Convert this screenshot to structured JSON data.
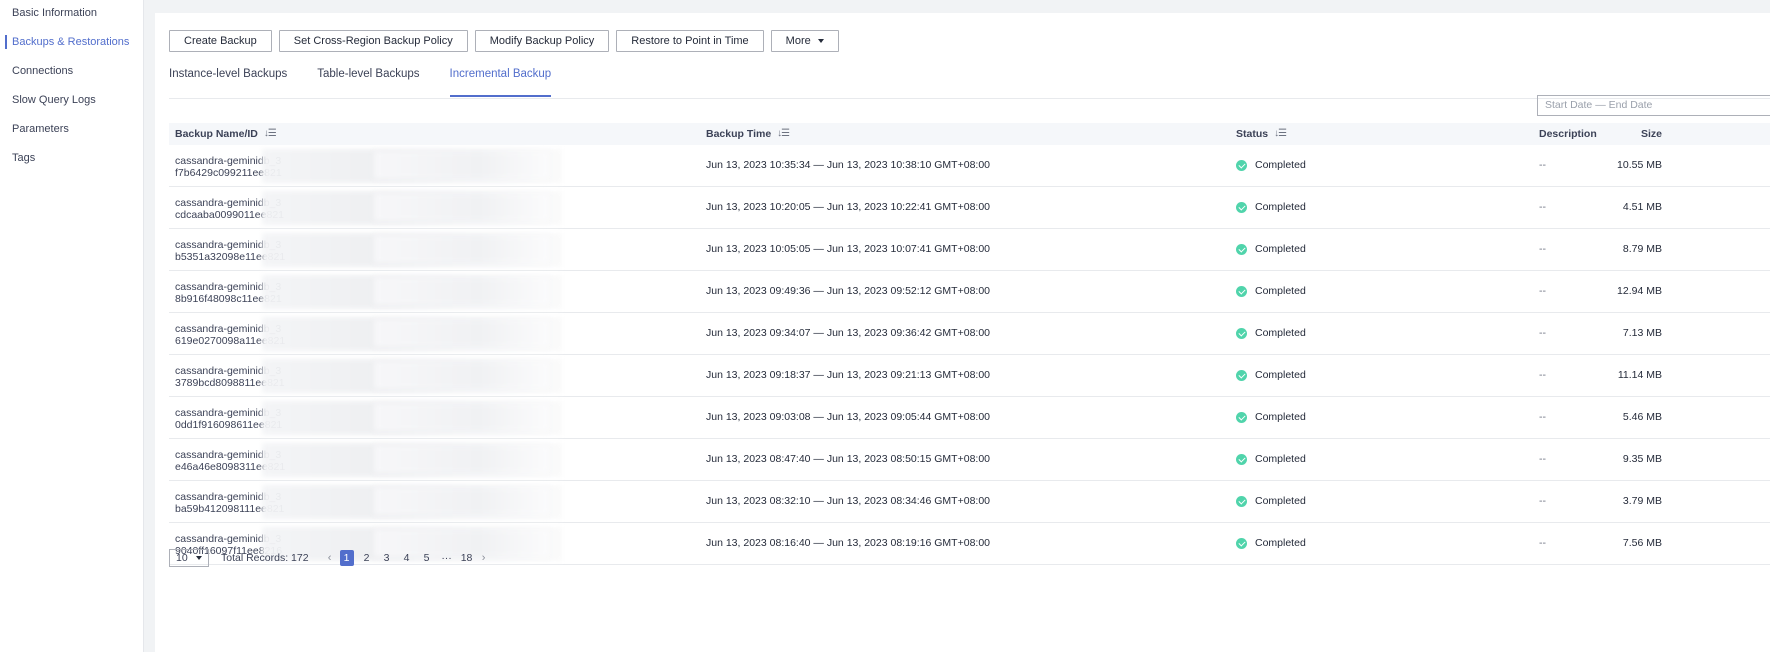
{
  "sidebar": {
    "items": [
      {
        "label": "Basic Information",
        "active": false
      },
      {
        "label": "Backups & Restorations",
        "active": true
      },
      {
        "label": "Connections",
        "active": false
      },
      {
        "label": "Slow Query Logs",
        "active": false
      },
      {
        "label": "Parameters",
        "active": false
      },
      {
        "label": "Tags",
        "active": false
      }
    ]
  },
  "toolbar": {
    "create_backup": "Create Backup",
    "cross_region_policy": "Set Cross-Region Backup Policy",
    "modify_policy": "Modify Backup Policy",
    "restore_pitr": "Restore to Point in Time",
    "more": "More"
  },
  "tabs": [
    {
      "label": "Instance-level Backups",
      "active": false
    },
    {
      "label": "Table-level Backups",
      "active": false
    },
    {
      "label": "Incremental Backup",
      "active": true
    }
  ],
  "filter": {
    "date_placeholder": "Start Date — End Date"
  },
  "table": {
    "headers": {
      "name": "Backup Name/ID",
      "time": "Backup Time",
      "status": "Status",
      "size": "Size",
      "description": "Description"
    },
    "sort_icon": "sort-icon",
    "status_icon_color": "#50d4ab",
    "rows": [
      {
        "name": "cassandra-geminidb_3",
        "id": "f7b6429c099211ee821",
        "time": "Jun 13, 2023 10:35:34 — Jun 13, 2023 10:38:10 GMT+08:00",
        "status": "Completed",
        "size": "10.55 MB",
        "description": "--"
      },
      {
        "name": "cassandra-geminidb_3",
        "id": "cdcaaba0099011ee821",
        "time": "Jun 13, 2023 10:20:05 — Jun 13, 2023 10:22:41 GMT+08:00",
        "status": "Completed",
        "size": "4.51 MB",
        "description": "--"
      },
      {
        "name": "cassandra-geminidb_3",
        "id": "b5351a32098e11ee821",
        "time": "Jun 13, 2023 10:05:05 — Jun 13, 2023 10:07:41 GMT+08:00",
        "status": "Completed",
        "size": "8.79 MB",
        "description": "--"
      },
      {
        "name": "cassandra-geminidb_3",
        "id": "8b916f48098c11ee821",
        "time": "Jun 13, 2023 09:49:36 — Jun 13, 2023 09:52:12 GMT+08:00",
        "status": "Completed",
        "size": "12.94 MB",
        "description": "--"
      },
      {
        "name": "cassandra-geminidb_3",
        "id": "619e0270098a11ee821",
        "time": "Jun 13, 2023 09:34:07 — Jun 13, 2023 09:36:42 GMT+08:00",
        "status": "Completed",
        "size": "7.13 MB",
        "description": "--"
      },
      {
        "name": "cassandra-geminidb_3",
        "id": "3789bcd8098811ee821",
        "time": "Jun 13, 2023 09:18:37 — Jun 13, 2023 09:21:13 GMT+08:00",
        "status": "Completed",
        "size": "11.14 MB",
        "description": "--"
      },
      {
        "name": "cassandra-geminidb_3",
        "id": "0dd1f916098611ee821",
        "time": "Jun 13, 2023 09:03:08 — Jun 13, 2023 09:05:44 GMT+08:00",
        "status": "Completed",
        "size": "5.46 MB",
        "description": "--"
      },
      {
        "name": "cassandra-geminidb_3",
        "id": "e46a46e8098311ee821",
        "time": "Jun 13, 2023 08:47:40 — Jun 13, 2023 08:50:15 GMT+08:00",
        "status": "Completed",
        "size": "9.35 MB",
        "description": "--"
      },
      {
        "name": "cassandra-geminidb_3",
        "id": "ba59b412098111ee821",
        "time": "Jun 13, 2023 08:32:10 — Jun 13, 2023 08:34:46 GMT+08:00",
        "status": "Completed",
        "size": "3.79 MB",
        "description": "--"
      },
      {
        "name": "cassandra-geminidb_3",
        "id": "9040ff16097f11ee8216",
        "time": "Jun 13, 2023 08:16:40 — Jun 13, 2023 08:19:16 GMT+08:00",
        "status": "Completed",
        "size": "7.56 MB",
        "description": "--"
      }
    ]
  },
  "pagination": {
    "page_size": "10",
    "total": "Total Records: 172",
    "prev": "‹",
    "next": "›",
    "pages": [
      "1",
      "2",
      "3",
      "4",
      "5",
      "···",
      "18"
    ],
    "current": "1"
  },
  "colors": {
    "accent": "#526ecc",
    "success": "#50d4ab"
  }
}
